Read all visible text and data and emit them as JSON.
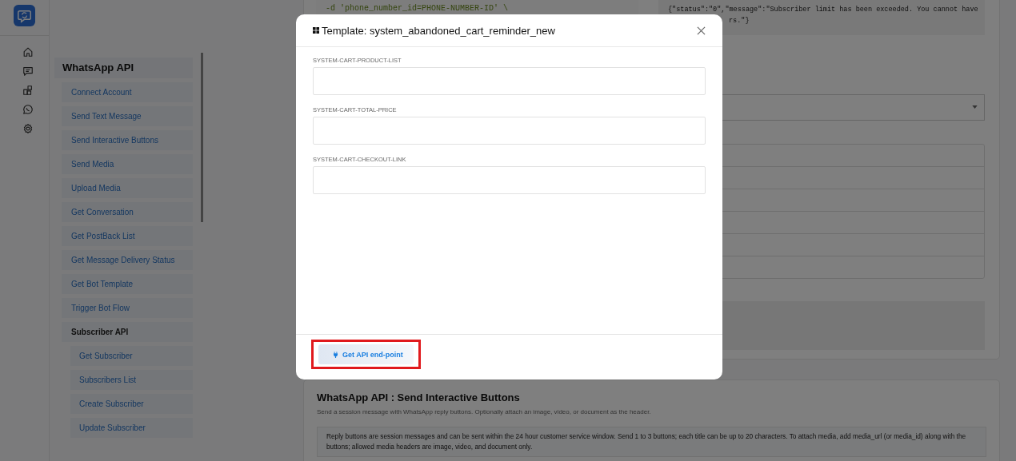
{
  "menu": {
    "title": "WhatsApp API",
    "items": [
      {
        "label": "Connect Account",
        "kind": "link"
      },
      {
        "label": "Send Text Message",
        "kind": "link"
      },
      {
        "label": "Send Interactive Buttons",
        "kind": "link"
      },
      {
        "label": "Send Media",
        "kind": "link"
      },
      {
        "label": "Upload Media",
        "kind": "link"
      },
      {
        "label": "Get Conversation",
        "kind": "link"
      },
      {
        "label": "Get PostBack List",
        "kind": "link"
      },
      {
        "label": "Get Message Delivery Status",
        "kind": "link"
      },
      {
        "label": "Get Bot Template",
        "kind": "link"
      },
      {
        "label": "Trigger Bot Flow",
        "kind": "link"
      },
      {
        "label": "Subscriber API",
        "kind": "group",
        "children": [
          {
            "label": "Get Subscriber",
            "kind": "link"
          },
          {
            "label": "Subscribers List",
            "kind": "link"
          },
          {
            "label": "Create Subscriber",
            "kind": "link"
          },
          {
            "label": "Update Subscriber",
            "kind": "link"
          }
        ]
      }
    ]
  },
  "background": {
    "code_line": "-d 'phone_number_id=PHONE-NUMBER-ID' \\",
    "response_lines": [
      "{\"status\":\"0\",\"message\":\"Subscriber limit has been exceeded. You cannot have",
      "rs.\"}"
    ],
    "next_card": {
      "title": "WhatsApp API : Send Interactive Buttons",
      "description": "Send a session message with WhatsApp reply buttons. Optionally attach an image, video, or document as the header.",
      "note": "Reply buttons are session messages and can be sent within the 24 hour customer service window. Send 1 to 3 buttons; each title can be up to 20 characters. To attach media, add media_url (or media_id) along with the buttons; allowed media headers are image, video, and document only."
    }
  },
  "modal": {
    "title": "Template: system_abandoned_cart_reminder_new",
    "fields": [
      {
        "label": "SYSTEM-CART-PRODUCT-LIST"
      },
      {
        "label": "SYSTEM-CART-TOTAL-PRICE"
      },
      {
        "label": "SYSTEM-CART-CHECKOUT-LINK"
      }
    ],
    "button": {
      "label": "Get API end-point",
      "highlighted": true
    }
  }
}
